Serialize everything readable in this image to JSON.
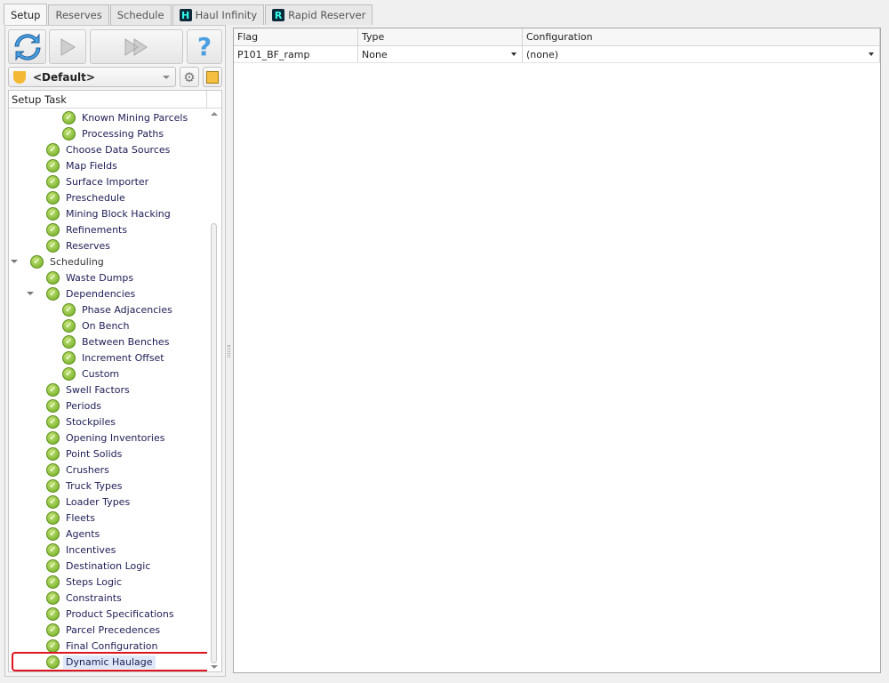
{
  "tabs": [
    {
      "label": "Setup",
      "active": true
    },
    {
      "label": "Reserves"
    },
    {
      "label": "Schedule"
    },
    {
      "label": "Haul Infinity",
      "icon": "H"
    },
    {
      "label": "Rapid Reserver",
      "icon": "R"
    }
  ],
  "toolbar": {
    "refresh": "refresh-icon",
    "run": "play-icon",
    "run_all": "fast-forward-icon",
    "help": "?"
  },
  "profile": {
    "selected": "<Default>"
  },
  "tree": {
    "header": "Setup Task",
    "items": [
      {
        "label": "Known Mining Parcels",
        "level": 2
      },
      {
        "label": "Processing Paths",
        "level": 2
      },
      {
        "label": "Choose Data Sources",
        "level": 1
      },
      {
        "label": "Map Fields",
        "level": 1
      },
      {
        "label": "Surface Importer",
        "level": 1
      },
      {
        "label": "Preschedule",
        "level": 1
      },
      {
        "label": "Mining Block Hacking",
        "level": 1
      },
      {
        "label": "Refinements",
        "level": 1
      },
      {
        "label": "Reserves",
        "level": 1
      },
      {
        "label": "Scheduling",
        "level": 0,
        "expanded": true
      },
      {
        "label": "Waste Dumps",
        "level": 1
      },
      {
        "label": "Dependencies",
        "level": 1,
        "expanded": true
      },
      {
        "label": "Phase Adjacencies",
        "level": 2
      },
      {
        "label": "On Bench",
        "level": 2
      },
      {
        "label": "Between Benches",
        "level": 2
      },
      {
        "label": "Increment Offset",
        "level": 2
      },
      {
        "label": "Custom",
        "level": 2
      },
      {
        "label": "Swell Factors",
        "level": 1
      },
      {
        "label": "Periods",
        "level": 1
      },
      {
        "label": "Stockpiles",
        "level": 1
      },
      {
        "label": "Opening Inventories",
        "level": 1
      },
      {
        "label": "Point Solids",
        "level": 1
      },
      {
        "label": "Crushers",
        "level": 1
      },
      {
        "label": "Truck Types",
        "level": 1
      },
      {
        "label": "Loader Types",
        "level": 1
      },
      {
        "label": "Fleets",
        "level": 1
      },
      {
        "label": "Agents",
        "level": 1
      },
      {
        "label": "Incentives",
        "level": 1
      },
      {
        "label": "Destination Logic",
        "level": 1
      },
      {
        "label": "Steps Logic",
        "level": 1
      },
      {
        "label": "Constraints",
        "level": 1
      },
      {
        "label": "Product Specifications",
        "level": 1
      },
      {
        "label": "Parcel Precedences",
        "level": 1
      },
      {
        "label": "Final Configuration",
        "level": 1
      },
      {
        "label": "Dynamic Haulage",
        "level": 1,
        "selected": true
      }
    ]
  },
  "grid": {
    "columns": [
      "Flag",
      "Type",
      "Configuration"
    ],
    "rows": [
      {
        "flag": "P101_BF_ramp",
        "type": "None",
        "configuration": "(none)"
      }
    ]
  },
  "colors": {
    "highlight": "#e0141e",
    "selection": "#dfe8f8"
  }
}
